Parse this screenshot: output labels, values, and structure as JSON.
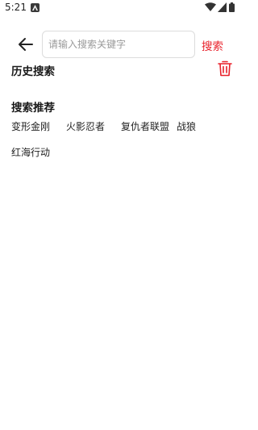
{
  "status_bar": {
    "time": "5:21",
    "icons": [
      "app-notification-icon",
      "wifi-icon",
      "cellular-signal-icon",
      "battery-icon"
    ]
  },
  "search": {
    "placeholder": "请输入搜索关键字",
    "value": "",
    "submit_label": "搜索",
    "back_icon": "arrow-left-icon"
  },
  "history": {
    "title": "历史搜索",
    "clear_icon": "trash-icon",
    "items": []
  },
  "recommend": {
    "title": "搜索推荐",
    "items": [
      "变形金刚",
      "火影忍者",
      "复仇者联盟",
      "战狼",
      "红海行动"
    ]
  },
  "colors": {
    "accent": "#e8202a",
    "text": "#1a1a1a",
    "placeholder": "#9a9a9a",
    "border": "#dcdcdc"
  }
}
